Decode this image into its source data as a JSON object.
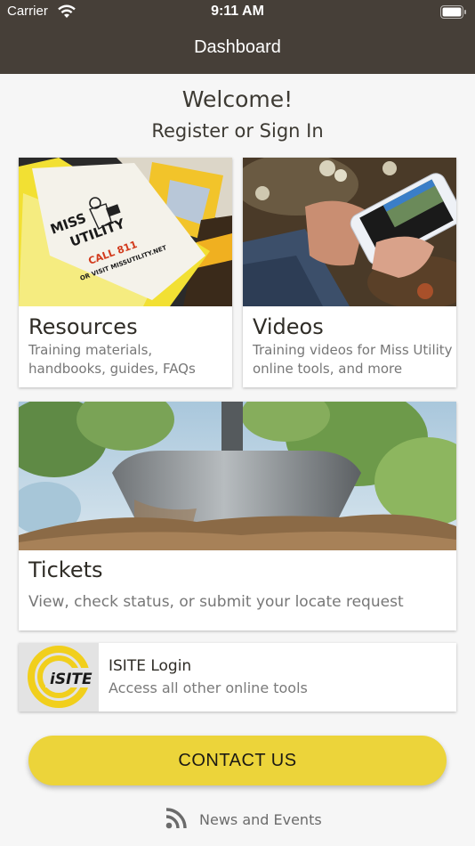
{
  "status_bar": {
    "carrier": "Carrier",
    "time": "9:11 AM"
  },
  "nav": {
    "title": "Dashboard"
  },
  "header": {
    "welcome": "Welcome!",
    "register": "Register or Sign In"
  },
  "cards": {
    "resources": {
      "title": "Resources",
      "desc_line1": "Training materials,",
      "desc_line2": "handbooks, guides, FAQs",
      "photo_text": {
        "line1": "MISS",
        "line2": "UTILITY",
        "line3": "CALL 811",
        "line4": "OR VISIT MISSUTILITY.NET"
      }
    },
    "videos": {
      "title": "Videos",
      "desc_line1": "Training videos for Miss Utility",
      "desc_line2": "online tools, and more"
    },
    "tickets": {
      "title": "Tickets",
      "desc": "View, check status, or submit your locate request"
    },
    "isite": {
      "title": "ISITE Login",
      "desc": "Access all other online tools",
      "logo_text": "iSITE"
    }
  },
  "contact": {
    "label": "CONTACT US"
  },
  "news": {
    "label": "News and Events",
    "icon": "rss-icon"
  },
  "colors": {
    "nav_bg": "#463f38",
    "accent_yellow": "#ecd43a",
    "page_bg": "#f6f6f6"
  }
}
